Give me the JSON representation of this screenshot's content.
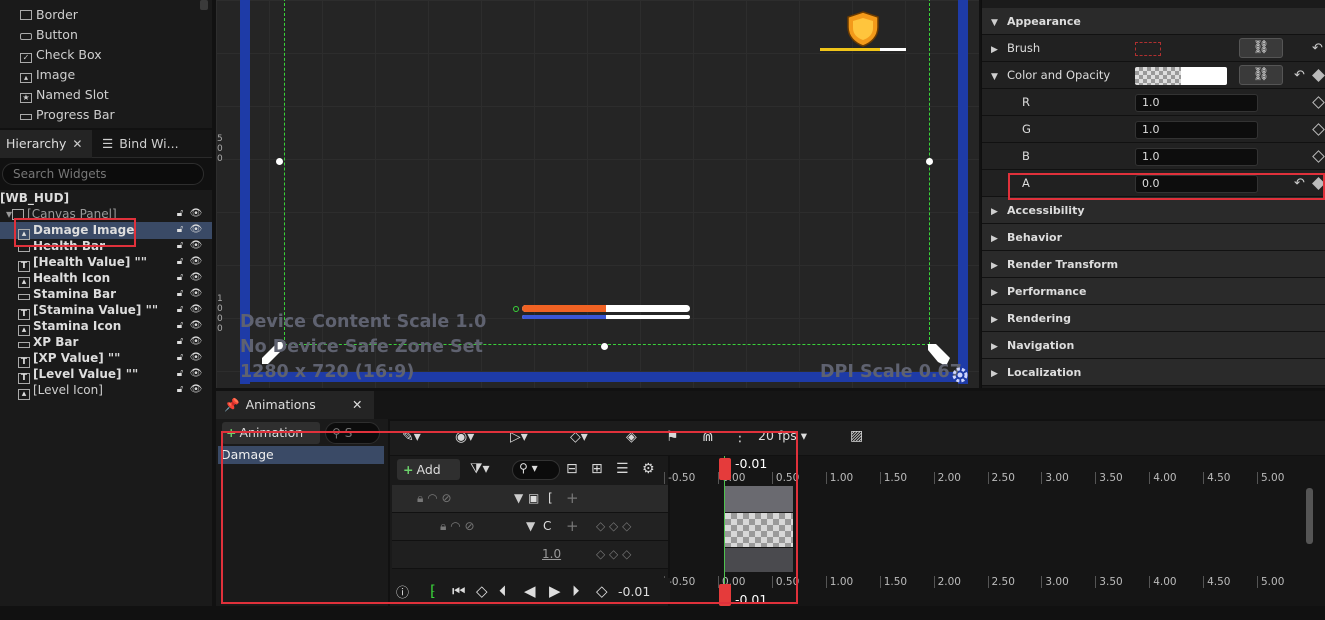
{
  "palette": {
    "items": [
      {
        "label": "Border",
        "icon": "border-icon"
      },
      {
        "label": "Button",
        "icon": "button-icon"
      },
      {
        "label": "Check Box",
        "icon": "checkbox-icon"
      },
      {
        "label": "Image",
        "icon": "image-icon"
      },
      {
        "label": "Named Slot",
        "icon": "named-slot-icon"
      },
      {
        "label": "Progress Bar",
        "icon": "progress-bar-icon"
      }
    ]
  },
  "hierarchy": {
    "tab_label": "Hierarchy",
    "bind_tab_label": "Bind Wi...",
    "search_placeholder": "Search Widgets",
    "root": "[WB_HUD]",
    "canvas": "[Canvas Panel]",
    "nodes": [
      {
        "label": "Damage Image",
        "icon": "image-icon",
        "selected": true
      },
      {
        "label": "Health Bar",
        "icon": "progress-bar-icon"
      },
      {
        "label": "[Health Value] \"\"",
        "icon": "text-icon"
      },
      {
        "label": "Health Icon",
        "icon": "image-icon"
      },
      {
        "label": "Stamina Bar",
        "icon": "progress-bar-icon"
      },
      {
        "label": "[Stamina Value] \"\"",
        "icon": "text-icon"
      },
      {
        "label": "Stamina Icon",
        "icon": "image-icon"
      },
      {
        "label": "XP Bar",
        "icon": "progress-bar-icon"
      },
      {
        "label": "[XP Value] \"\"",
        "icon": "text-icon"
      },
      {
        "label": "[Level Value] \"\"",
        "icon": "text-icon"
      },
      {
        "label": "[Level Icon]",
        "icon": "image-icon"
      }
    ]
  },
  "viewport": {
    "content_scale": "Device Content Scale 1.0",
    "safe_zone": "No Device Safe Zone Set",
    "resolution": "1280 x 720 (16:9)",
    "dpi": "DPI Scale 0.67",
    "ruler_top": [
      "5",
      "0",
      "0"
    ],
    "ruler_bottom": [
      "1",
      "0",
      "0",
      "0"
    ],
    "health_fill": 0.5,
    "stamina_fill": 0.5
  },
  "details": {
    "appearance": "Appearance",
    "brush": "Brush",
    "color_and_opacity": "Color and Opacity",
    "channels": [
      {
        "label": "R",
        "value": "1.0"
      },
      {
        "label": "G",
        "value": "1.0"
      },
      {
        "label": "B",
        "value": "1.0"
      },
      {
        "label": "A",
        "value": "0.0"
      }
    ],
    "sections": [
      "Accessibility",
      "Behavior",
      "Render Transform",
      "Performance",
      "Rendering",
      "Navigation",
      "Localization"
    ]
  },
  "animations": {
    "tab_label": "Animations",
    "add_label": "Animation",
    "search_placeholder": "S",
    "items": [
      "Damage"
    ]
  },
  "sequencer": {
    "add_label": "Add",
    "fps": "20 fps",
    "current_time": "-0.01",
    "track_value": "1.0",
    "track_label_1": "[",
    "track_label_2": "C",
    "ticks": [
      "-0.50",
      "0.00",
      "0.50",
      "1.00",
      "1.50",
      "2.00",
      "2.50",
      "3.00",
      "3.50",
      "4.00",
      "4.50",
      "5.00"
    ]
  }
}
